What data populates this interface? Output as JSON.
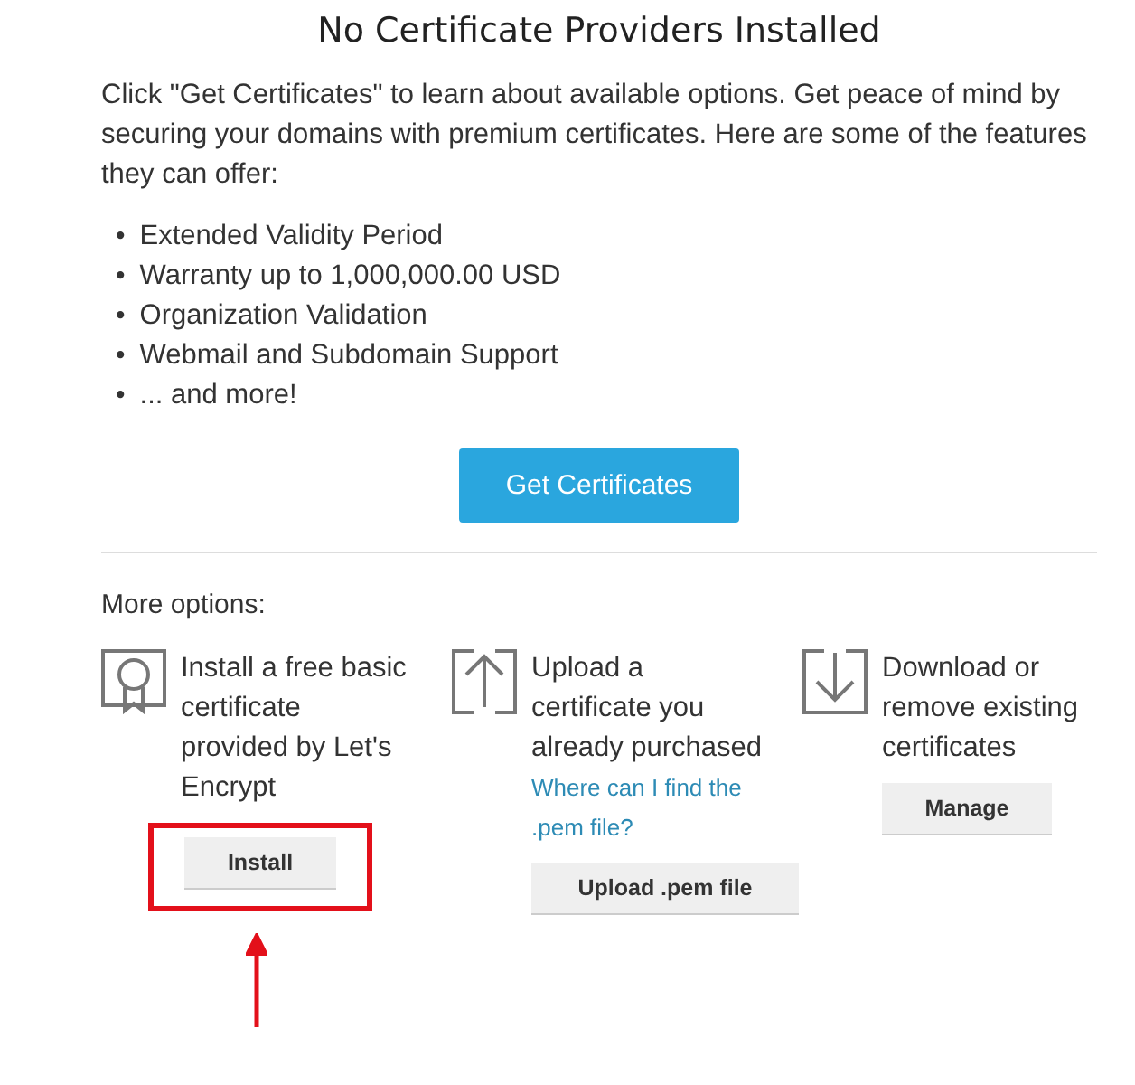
{
  "title": "No Certificate Providers Installed",
  "intro": "Click \"Get Certificates\" to learn about available options. Get peace of mind by securing your domains with premium certificates. Here are some of the features they can offer:",
  "features": [
    {
      "bullet": "•",
      "text": "Extended Validity Period"
    },
    {
      "bullet": "•",
      "text": "Warranty up to 1,000,000.00 USD"
    },
    {
      "bullet": "•",
      "text": "Organization Validation"
    },
    {
      "bullet": "•",
      "text": "Webmail and Subdomain Support"
    },
    {
      "bullet": "•",
      "text": "... and more!"
    }
  ],
  "primary_button": "Get Certificates",
  "more_options_label": "More options:",
  "options": [
    {
      "kind": "certificate",
      "text": "Install a free basic certificate provided by Let's Encrypt",
      "button": "Install",
      "highlighted": true
    },
    {
      "kind": "upload",
      "text": "Upload a certificate you already purchased",
      "link": "Where can I find the .pem file?",
      "button": "Upload .pem file",
      "highlighted": false
    },
    {
      "kind": "download",
      "text": "Download or remove existing certificates",
      "button": "Manage",
      "highlighted": false
    }
  ]
}
